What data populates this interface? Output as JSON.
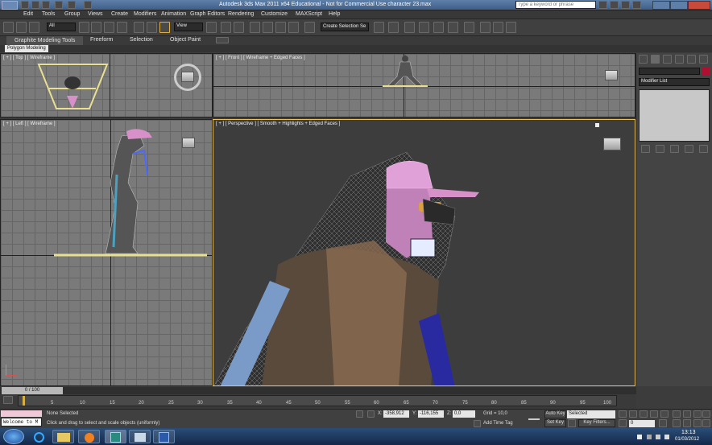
{
  "window": {
    "title": "Autodesk 3ds Max  2011 x64    Educational - Not for Commercial Use   character 23.max",
    "search_placeholder": "Type a keyword or phrase"
  },
  "menu": [
    "Edit",
    "Tools",
    "Group",
    "Views",
    "Create",
    "Modifiers",
    "Animation",
    "Graph Editors",
    "Rendering",
    "Customize",
    "MAXScript",
    "Help"
  ],
  "toolbar": {
    "selection_filter": "All",
    "reference_coord": "View",
    "named_selection": "Create Selection Se"
  },
  "ribbon": {
    "tabs": [
      "Graphite Modeling Tools",
      "Freeform",
      "Selection",
      "Object Paint"
    ],
    "sub_tab": "Polygon Modeling"
  },
  "viewports": {
    "top": "[ + ] [ Top ] [ Wireframe ]",
    "front": "[ + ] [ Front ] [ Wireframe + Edged Faces ]",
    "left": "[ + ] [ Left ] [ Wireframe ]",
    "perspective": "[ + ] [ Perspective ] [ Smooth + Highlights + Edged Faces ]"
  },
  "command_panel": {
    "modifier_list": "Modifier List"
  },
  "timeline": {
    "frame_counter": "0 / 100",
    "ticks": [
      "5",
      "10",
      "15",
      "20",
      "25",
      "30",
      "35",
      "40",
      "45",
      "50",
      "55",
      "60",
      "65",
      "70",
      "75",
      "80",
      "85",
      "90",
      "95",
      "100"
    ]
  },
  "status": {
    "listener": "Welcome to M",
    "selection": "None Selected",
    "prompt": "Click and drag to select and scale objects (uniformly)",
    "x_label": "X:",
    "x_value": "-358,912",
    "y_label": "Y:",
    "y_value": "-116,155",
    "z_label": "Z:",
    "z_value": "0,0",
    "grid": "Grid = 10,0",
    "add_time_tag": "Add Time Tag",
    "auto_key": "Auto Key",
    "set_key": "Set Key",
    "key_mode": "Selected",
    "key_filters": "Key Filters...",
    "current_frame": "0"
  },
  "taskbar": {
    "time": "13:13",
    "date": "01/03/2012"
  },
  "colors": {
    "viewport_bg": "#7a7a7a",
    "perspective_bg": "#3d3d3d",
    "active_border": "#e8c060",
    "cap_pink": "#d890c8",
    "key_red": "#b01030"
  }
}
